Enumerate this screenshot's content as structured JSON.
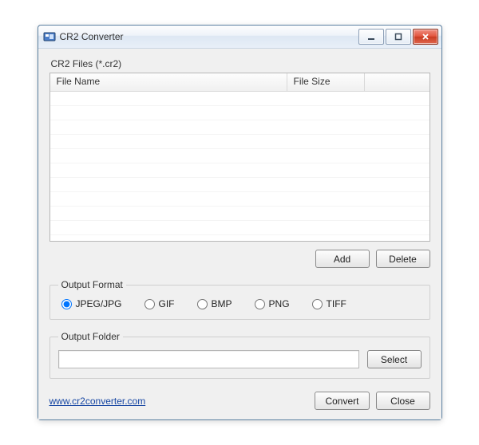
{
  "window": {
    "title": "CR2 Converter"
  },
  "filesGroup": {
    "label": "CR2 Files (*.cr2)",
    "columns": {
      "name": "File Name",
      "size": "File Size"
    }
  },
  "buttons": {
    "add": "Add",
    "delete": "Delete",
    "select": "Select",
    "convert": "Convert",
    "close": "Close"
  },
  "formatGroup": {
    "legend": "Output Format",
    "options": {
      "jpeg": "JPEG/JPG",
      "gif": "GIF",
      "bmp": "BMP",
      "png": "PNG",
      "tiff": "TIFF"
    },
    "selected": "jpeg"
  },
  "folderGroup": {
    "legend": "Output Folder",
    "value": ""
  },
  "footer": {
    "link": "www.cr2converter.com"
  }
}
